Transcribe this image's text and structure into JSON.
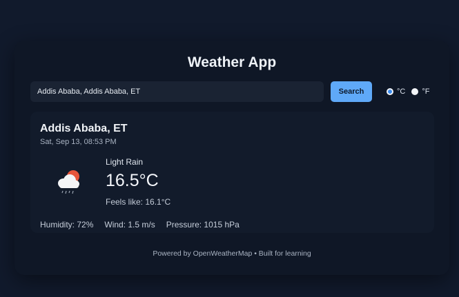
{
  "app": {
    "title": "Weather App"
  },
  "search": {
    "value": "Addis Ababa, Addis Ababa, ET",
    "button_label": "Search"
  },
  "units": {
    "celsius_label": "°C",
    "fahrenheit_label": "°F",
    "selected": "celsius"
  },
  "weather": {
    "city": "Addis Ababa, ET",
    "datetime": "Sat, Sep 13, 08:53 PM",
    "condition": "Light Rain",
    "temperature": "16.5°C",
    "feels_like": "Feels like: 16.1°C",
    "humidity": "Humidity: 72%",
    "wind": "Wind: 1.5 m/s",
    "pressure": "Pressure: 1015 hPa",
    "icon": "rain-cloud-sun-icon"
  },
  "footer": {
    "text": "Powered by OpenWeatherMap • Built for learning"
  },
  "colors": {
    "accent": "#5fa9f8",
    "background": "#111a2c",
    "card": "#0f1726"
  }
}
